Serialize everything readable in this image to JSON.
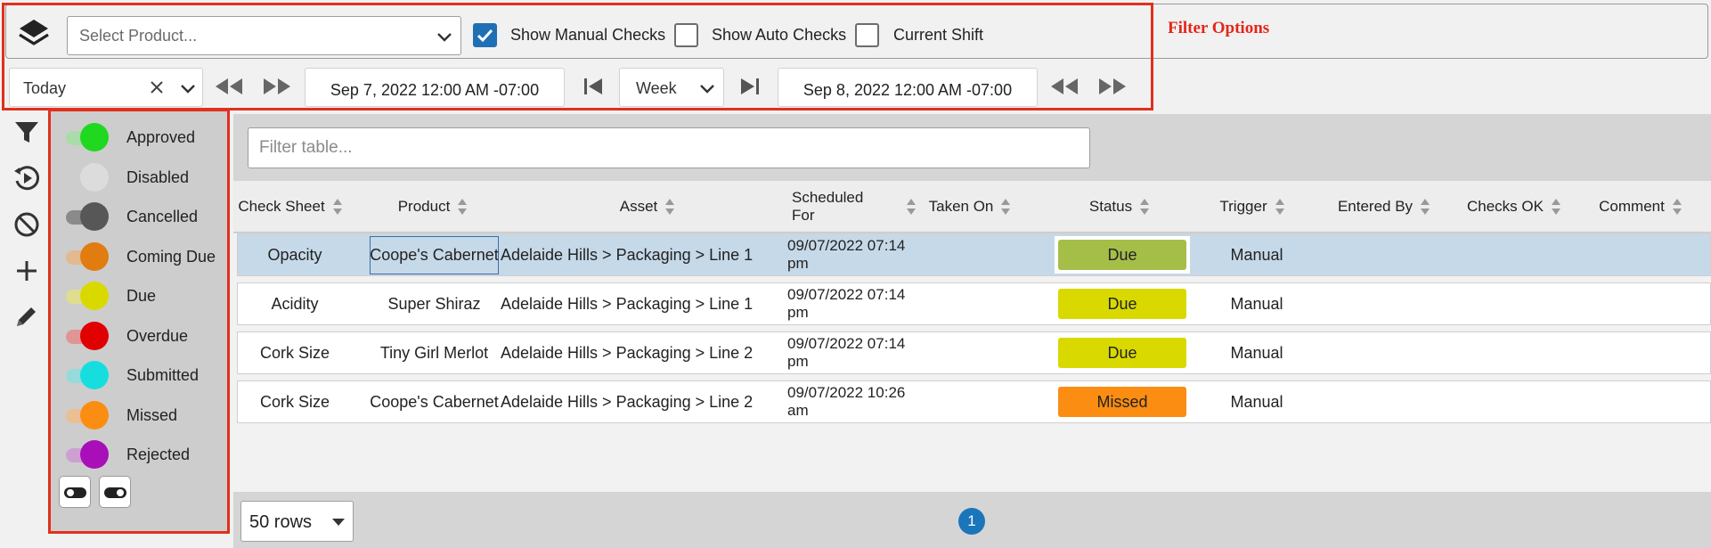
{
  "filter_options_label": "Filter Options",
  "product_select": {
    "placeholder": "Select Product..."
  },
  "checkboxes": [
    {
      "label": "Show Manual Checks",
      "checked": true
    },
    {
      "label": "Show Auto Checks",
      "checked": false
    },
    {
      "label": "Current Shift",
      "checked": false
    }
  ],
  "date_range": {
    "preset": "Today",
    "start": "Sep 7, 2022 12:00 AM -07:00",
    "period": "Week",
    "end": "Sep 8, 2022 12:00 AM -07:00"
  },
  "tools": [
    "filter-icon",
    "history-icon",
    "block-icon",
    "plus-icon",
    "pencil-icon"
  ],
  "legend": [
    {
      "label": "Approved",
      "color": "#1fd81f",
      "track": "#a9dca9"
    },
    {
      "label": "Disabled",
      "color": "#dcdcdc",
      "track": "#cdcdcd"
    },
    {
      "label": "Cancelled",
      "color": "#575757",
      "track": "#8a8a8a"
    },
    {
      "label": "Coming Due",
      "color": "#e07c10",
      "track": "#e3b990"
    },
    {
      "label": "Due",
      "color": "#d9d900",
      "track": "#dede8e"
    },
    {
      "label": "Overdue",
      "color": "#e00000",
      "track": "#e09595"
    },
    {
      "label": "Submitted",
      "color": "#17dede",
      "track": "#96dbdb"
    },
    {
      "label": "Missed",
      "color": "#fb8d12",
      "track": "#e9bf93"
    },
    {
      "label": "Rejected",
      "color": "#a80fb8",
      "track": "#cea0d2"
    }
  ],
  "table": {
    "filter_placeholder": "Filter table...",
    "columns": [
      "Check Sheet",
      "Product",
      "Asset",
      "Scheduled For",
      "Taken On",
      "Status",
      "Trigger",
      "Entered By",
      "Checks OK",
      "Comment"
    ],
    "rows": [
      {
        "check_sheet": "Opacity",
        "product": "Coope's Cabernet",
        "asset": "Adelaide Hills > Packaging > Line 1",
        "scheduled": "09/07/2022 07:14 pm",
        "taken_on": "",
        "status": "Due",
        "status_color": "#a5be47",
        "trigger": "Manual",
        "entered_by": "",
        "checks_ok": "",
        "comment": "",
        "selected": true
      },
      {
        "check_sheet": "Acidity",
        "product": "Super Shiraz",
        "asset": "Adelaide Hills > Packaging > Line 1",
        "scheduled": "09/07/2022 07:14 pm",
        "taken_on": "",
        "status": "Due",
        "status_color": "#d9d900",
        "trigger": "Manual",
        "entered_by": "",
        "checks_ok": "",
        "comment": "",
        "selected": false
      },
      {
        "check_sheet": "Cork Size",
        "product": "Tiny Girl Merlot",
        "asset": "Adelaide Hills > Packaging > Line 2",
        "scheduled": "09/07/2022 07:14 pm",
        "taken_on": "",
        "status": "Due",
        "status_color": "#d9d900",
        "trigger": "Manual",
        "entered_by": "",
        "checks_ok": "",
        "comment": "",
        "selected": false
      },
      {
        "check_sheet": "Cork Size",
        "product": "Coope's Cabernet",
        "asset": "Adelaide Hills > Packaging > Line 2",
        "scheduled": "09/07/2022 10:26 am",
        "taken_on": "",
        "status": "Missed",
        "status_color": "#fb8d12",
        "trigger": "Manual",
        "entered_by": "",
        "checks_ok": "",
        "comment": "",
        "selected": false
      }
    ]
  },
  "pagination": {
    "rows_per_page": "50 rows",
    "current_page": "1"
  }
}
